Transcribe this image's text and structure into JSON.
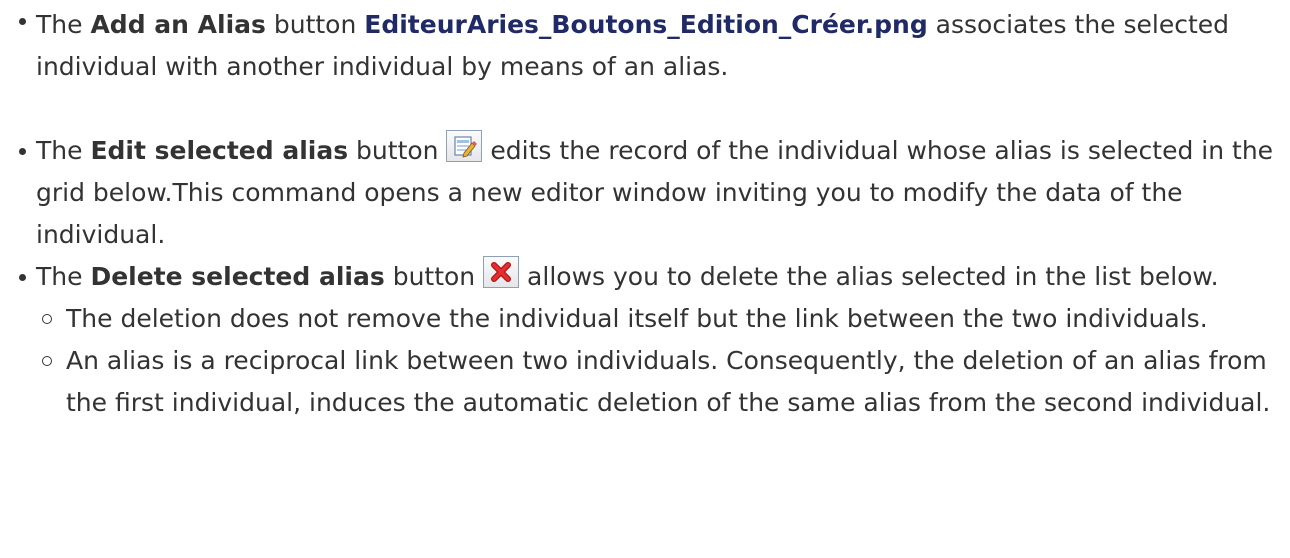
{
  "items": [
    {
      "prefix": "The ",
      "label": "Add an Alias",
      "after_label": " button ",
      "icon_alt": "EditeurAries_Boutons_Edition_Créer.png",
      "text": " associates the selected individual with another individual by means of an alias."
    },
    {
      "prefix": "The ",
      "label": "Edit selected alias",
      "after_label": " button ",
      "icon": "edit-icon",
      "text": " edits the record of the individual whose alias is selected in the grid below.This command opens a new editor window inviting you to modify the data of the individual."
    },
    {
      "prefix": "The ",
      "label": "Delete selected alias",
      "after_label": " button ",
      "icon": "delete-icon",
      "text": " allows you to delete the alias selected in the list below.",
      "subitems": [
        "The deletion does not remove the individual itself but the link between the two individuals.",
        "An alias is a reciprocal link between two individuals. Consequently, the deletion of an alias from the first individual, induces the automatic deletion of the same alias from the second individual."
      ]
    }
  ],
  "colors": {
    "text": "#333333",
    "alt_text": "#1f2a66",
    "delete_x": "#d01818",
    "edit_icon": "#5a8fc8"
  }
}
